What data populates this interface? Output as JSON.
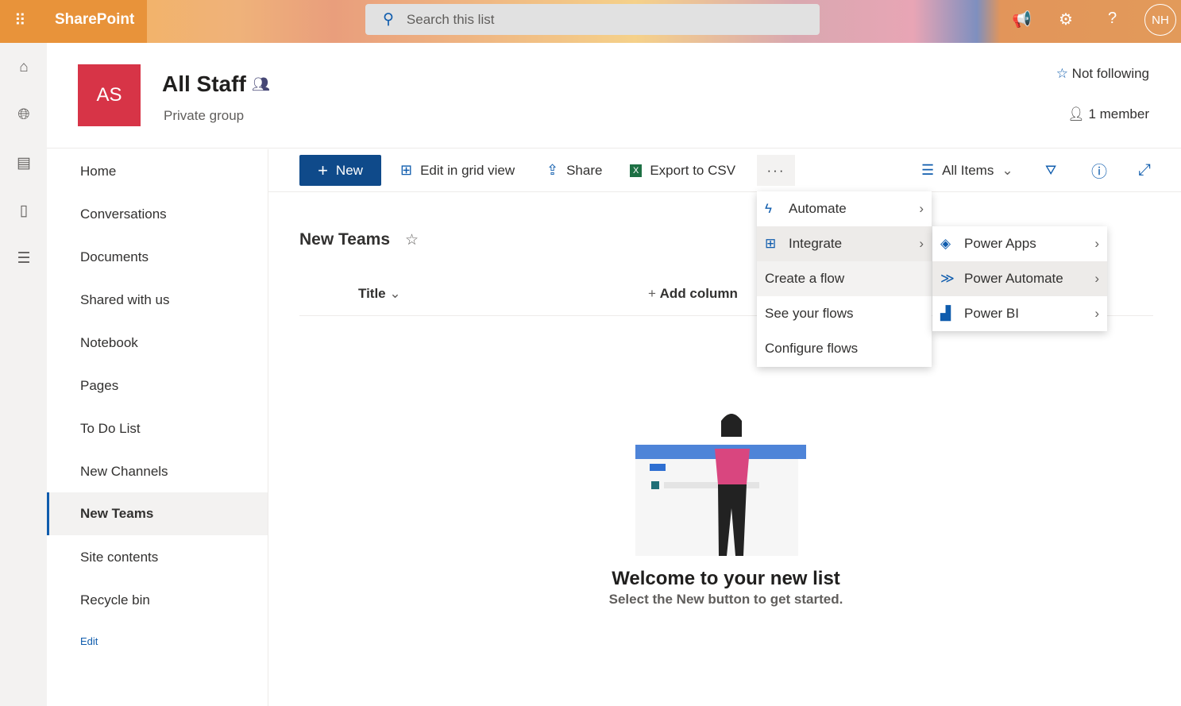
{
  "suite": {
    "app_name": "SharePoint",
    "search_placeholder": "Search this list",
    "user_initials": "NH"
  },
  "site": {
    "logo_initials": "AS",
    "title": "All Staff",
    "subtitle": "Private group",
    "follow_label": "Not following",
    "members_label": "1 member"
  },
  "nav": {
    "items": [
      "Home",
      "Conversations",
      "Documents",
      "Shared with us",
      "Notebook",
      "Pages",
      "To Do List",
      "New Channels",
      "New Teams",
      "Site contents",
      "Recycle bin"
    ],
    "selected": "New Teams",
    "edit_label": "Edit"
  },
  "commands": {
    "new": "New",
    "edit_grid": "Edit in grid view",
    "share": "Share",
    "export": "Export to CSV",
    "more": "···",
    "view": "All Items"
  },
  "list": {
    "title": "New Teams",
    "columns": [
      "Title",
      "Add column"
    ]
  },
  "menu": {
    "items": [
      "Automate",
      "Integrate",
      "Create a flow",
      "See your flows",
      "Configure flows"
    ]
  },
  "submenu": {
    "items": [
      "Power Apps",
      "Power Automate",
      "Power BI"
    ]
  },
  "empty": {
    "title": "Welcome to your new list",
    "subtitle": "Select the New button to get started."
  }
}
